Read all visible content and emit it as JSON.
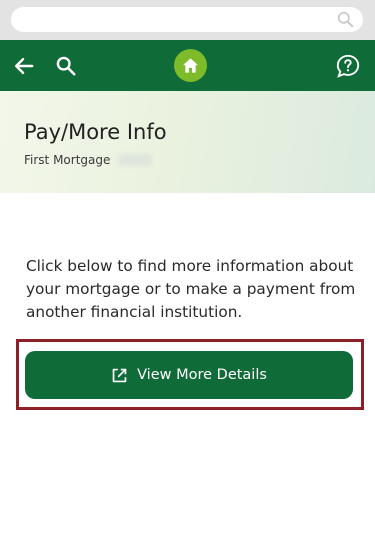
{
  "browser": {
    "address_bar_text": "",
    "search_icon": "search-icon"
  },
  "header": {
    "back_icon": "arrow-left-icon",
    "search_icon": "search-icon",
    "home_icon": "home-icon",
    "help_icon": "help-chat-icon",
    "bar_color": "#0f6b38",
    "home_badge_color": "#7dbb2a"
  },
  "page": {
    "title": "Pay/More Info",
    "subtitle": "First Mortgage",
    "description": "Click below to find more information about your mortgage or to make a payment from another financial institution."
  },
  "actions": {
    "view_details_label": "View More Details",
    "view_details_icon": "external-link-icon",
    "button_color": "#0f6b38",
    "highlight_color": "#8e1f28"
  }
}
